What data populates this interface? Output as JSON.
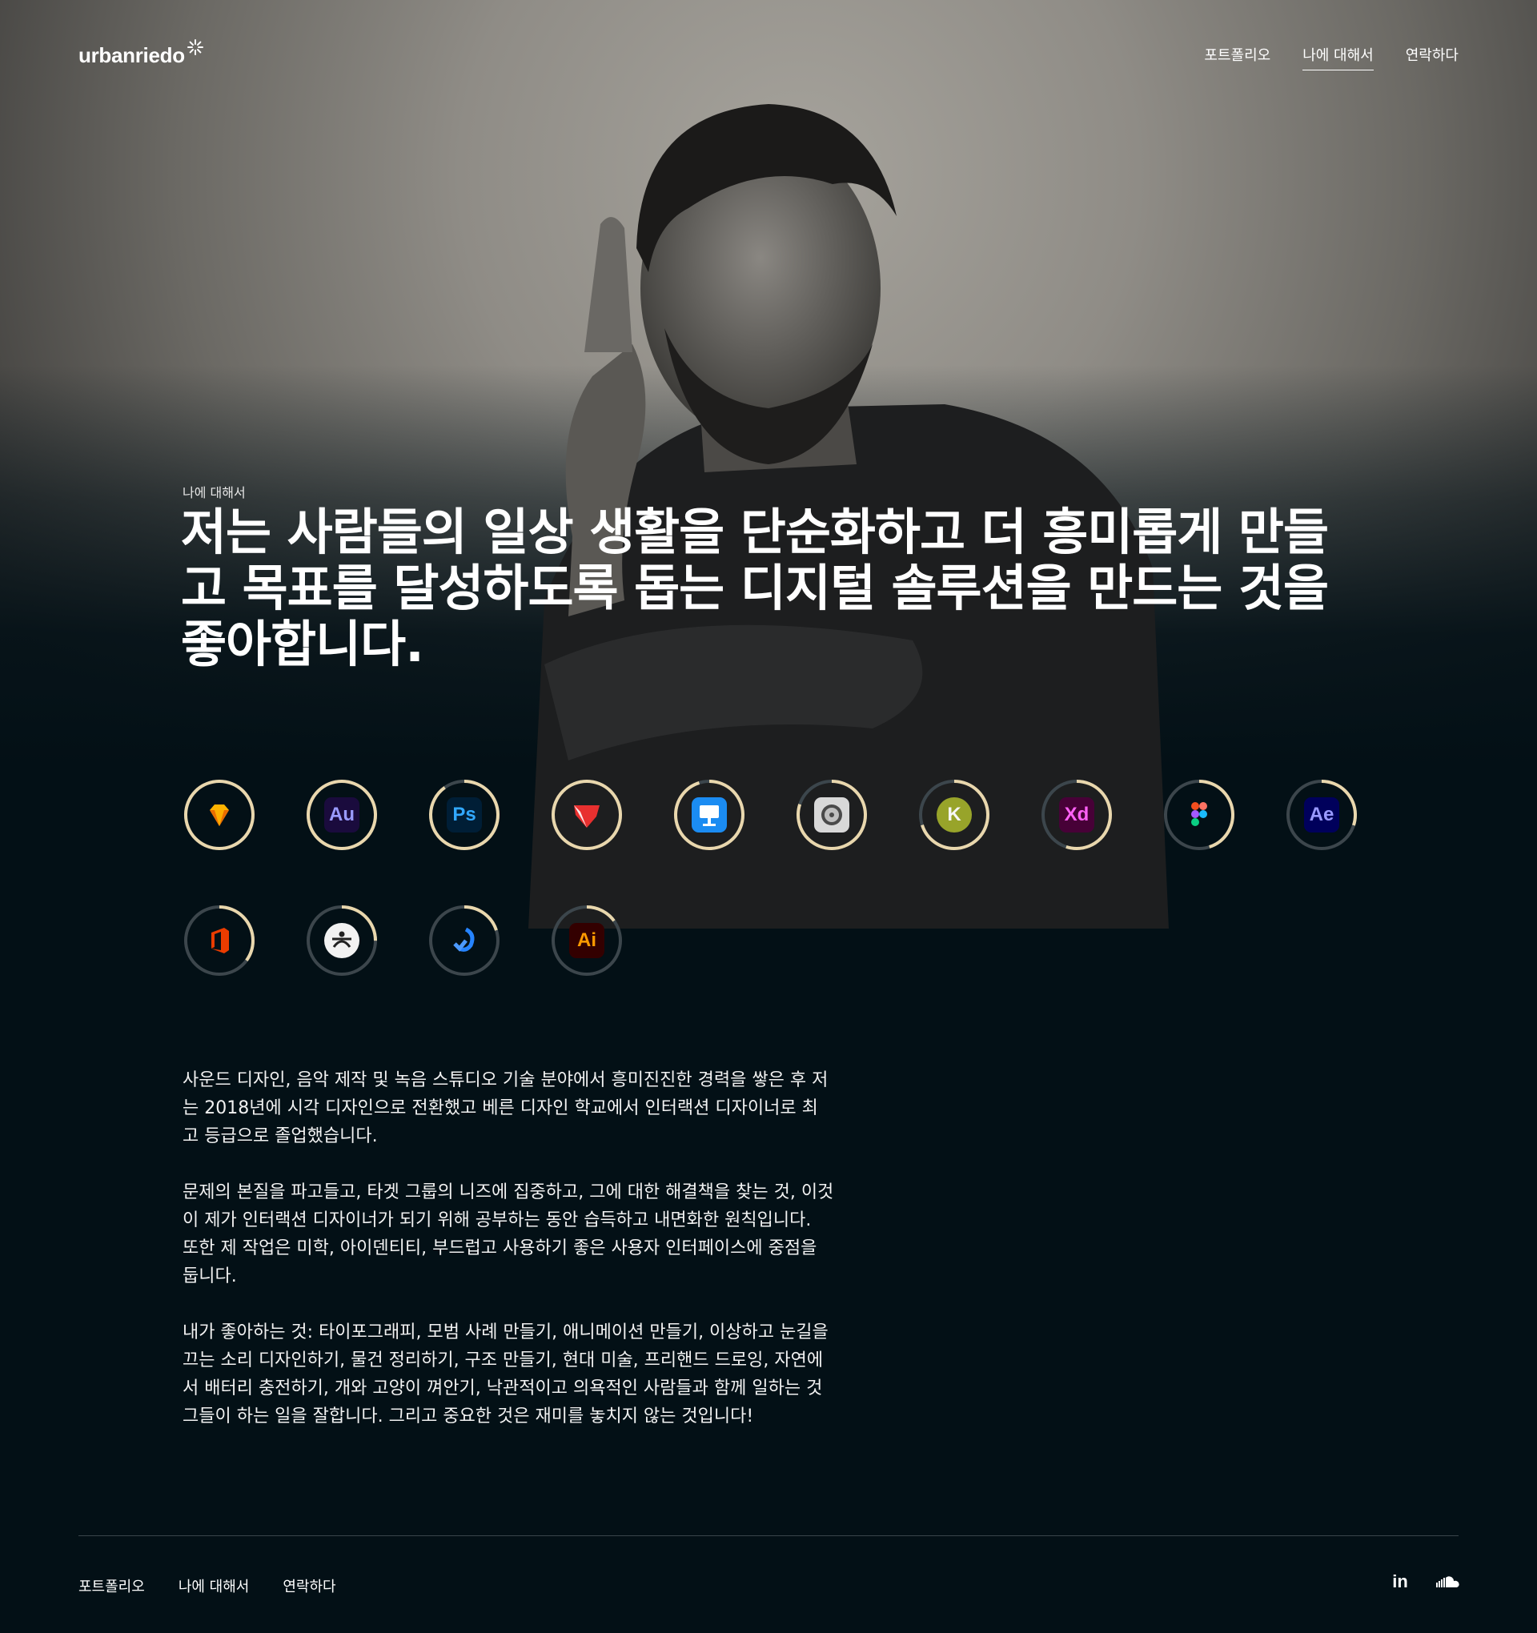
{
  "brand": {
    "name": "urbanriedo"
  },
  "nav": {
    "items": [
      "포트폴리오",
      "나에 대해서",
      "연락하다"
    ],
    "active": 1
  },
  "hero": {
    "eyebrow": "나에 대해서",
    "headline_lines": [
      "저는 사람들의 일상 생활을 단순화하고 더 흥미롭게 만들",
      "고 목표를 달성하도록 돕는 디지털 솔루션을 만드는 것을",
      "좋아합니다."
    ]
  },
  "skills": [
    {
      "icon": "sketch-icon",
      "label": "",
      "progress": 1.0,
      "bg": "#fff4d6",
      "fg": "#f7a21b"
    },
    {
      "icon": "audition-icon",
      "label": "Au",
      "progress": 1.0,
      "bg": "#1a0b3d",
      "fg": "#9a9bff"
    },
    {
      "icon": "photoshop-icon",
      "label": "Ps",
      "progress": 0.9,
      "bg": "#001e36",
      "fg": "#31a8ff"
    },
    {
      "icon": "principle-icon",
      "label": "",
      "progress": 1.0,
      "bg": "#ffffff",
      "fg": "#e8302f"
    },
    {
      "icon": "keynote-icon",
      "label": "",
      "progress": 0.95,
      "bg": "#1b8cf2",
      "fg": "#ffffff"
    },
    {
      "icon": "logic-pro-icon",
      "label": "",
      "progress": 0.8,
      "bg": "#d8d8d8",
      "fg": "#333333"
    },
    {
      "icon": "kotlin-k-icon",
      "label": "K",
      "progress": 0.7,
      "bg": "#f0f0f0",
      "fg": "#7a8b16"
    },
    {
      "icon": "adobe-xd-icon",
      "label": "Xd",
      "progress": 0.55,
      "bg": "#470137",
      "fg": "#ff61f6"
    },
    {
      "icon": "figma-icon",
      "label": "",
      "progress": 0.45,
      "bg": "transparent",
      "fg": "#ffffff"
    },
    {
      "icon": "after-effects-icon",
      "label": "Ae",
      "progress": 0.3,
      "bg": "#00005b",
      "fg": "#9999ff"
    },
    {
      "icon": "office-icon",
      "label": "",
      "progress": 0.35,
      "bg": "transparent",
      "fg": "#eb3c00"
    },
    {
      "icon": "zbrush-icon",
      "label": "",
      "progress": 0.25,
      "bg": "#f2f2f2",
      "fg": "#222222"
    },
    {
      "icon": "jira-icon",
      "label": "",
      "progress": 0.2,
      "bg": "transparent",
      "fg": "#2684ff"
    },
    {
      "icon": "illustrator-icon",
      "label": "Ai",
      "progress": 0.15,
      "bg": "#330000",
      "fg": "#ff9a00"
    }
  ],
  "colors": {
    "ring_progress": "#e9d7ad",
    "ring_track": "#3c464c",
    "background": "#031016"
  },
  "bio": {
    "paragraphs": [
      [
        "사운드 디자인, 음악 제작 및 녹음 스튜디오 기술 분야에서 흥미진진한 경력을 쌓은 후 저",
        "는 2018년에 시각 디자인으로 전환했고 베른 디자인 학교에서 인터랙션 디자이너로 최",
        "고 등급으로 졸업했습니다."
      ],
      [
        "문제의 본질을 파고들고, 타겟 그룹의 니즈에 집중하고, 그에 대한 해결책을 찾는 것, 이것",
        "이 제가 인터랙션 디자이너가 되기 위해 공부하는 동안 습득하고 내면화한 원칙입니다.",
        "또한 제 작업은 미학, 아이덴티티, 부드럽고 사용하기 좋은 사용자 인터페이스에 중점을",
        "둡니다."
      ],
      [
        "내가 좋아하는 것: 타이포그래피, 모범 사례 만들기, 애니메이션 만들기, 이상하고 눈길을",
        "끄는 소리 디자인하기, 물건 정리하기, 구조 만들기, 현대 미술, 프리핸드 드로잉, 자연에",
        "서 배터리 충전하기, 개와 고양이 껴안기, 낙관적이고 의욕적인 사람들과 함께 일하는 것",
        "그들이 하는 일을 잘합니다. 그리고 중요한 것은 재미를 놓치지 않는 것입니다!"
      ]
    ]
  },
  "footer": {
    "nav": [
      "포트폴리오",
      "나에 대해서",
      "연락하다"
    ],
    "social": [
      {
        "icon": "linkedin-icon",
        "label": "in"
      },
      {
        "icon": "soundcloud-icon"
      }
    ]
  }
}
